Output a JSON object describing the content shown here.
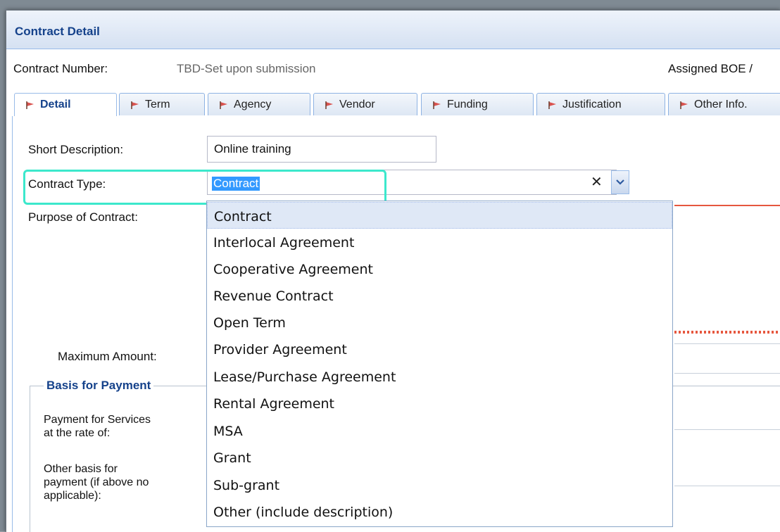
{
  "header": {
    "title": "Contract Detail"
  },
  "info_row": {
    "contract_number_label": "Contract Number:",
    "contract_number_value": "TBD-Set upon submission",
    "assigned_label": "Assigned BOE /"
  },
  "tabs": [
    {
      "label": "Detail",
      "active": true
    },
    {
      "label": "Term"
    },
    {
      "label": "Agency"
    },
    {
      "label": "Vendor"
    },
    {
      "label": "Funding"
    },
    {
      "label": "Justification"
    },
    {
      "label": "Other Info."
    }
  ],
  "form": {
    "short_description_label": "Short Description:",
    "short_description_value": "Online training",
    "contract_type_label": "Contract Type:",
    "contract_type_value": "Contract",
    "purpose_label": "Purpose of Contract:",
    "max_amount_label": "Maximum Amount:",
    "basis_legend": "Basis for Payment",
    "payment_services_label_1": "Payment for Services",
    "payment_services_label_2": "at the rate of:",
    "other_basis_label_1": "Other basis for",
    "other_basis_label_2": "payment (if above no",
    "other_basis_label_3": "applicable):"
  },
  "dropdown": {
    "options": [
      "Contract",
      "Interlocal Agreement",
      "Cooperative Agreement",
      "Revenue Contract",
      "Open Term",
      "Provider Agreement",
      "Lease/Purchase Agreement",
      "Rental Agreement",
      "MSA",
      "Grant",
      "Sub-grant",
      "Other (include description)"
    ],
    "selected_index": 0
  },
  "colors": {
    "accent": "#15428b",
    "highlight": "#3ce8cc",
    "selection": "#3399ff",
    "flag": "#d9534f"
  }
}
